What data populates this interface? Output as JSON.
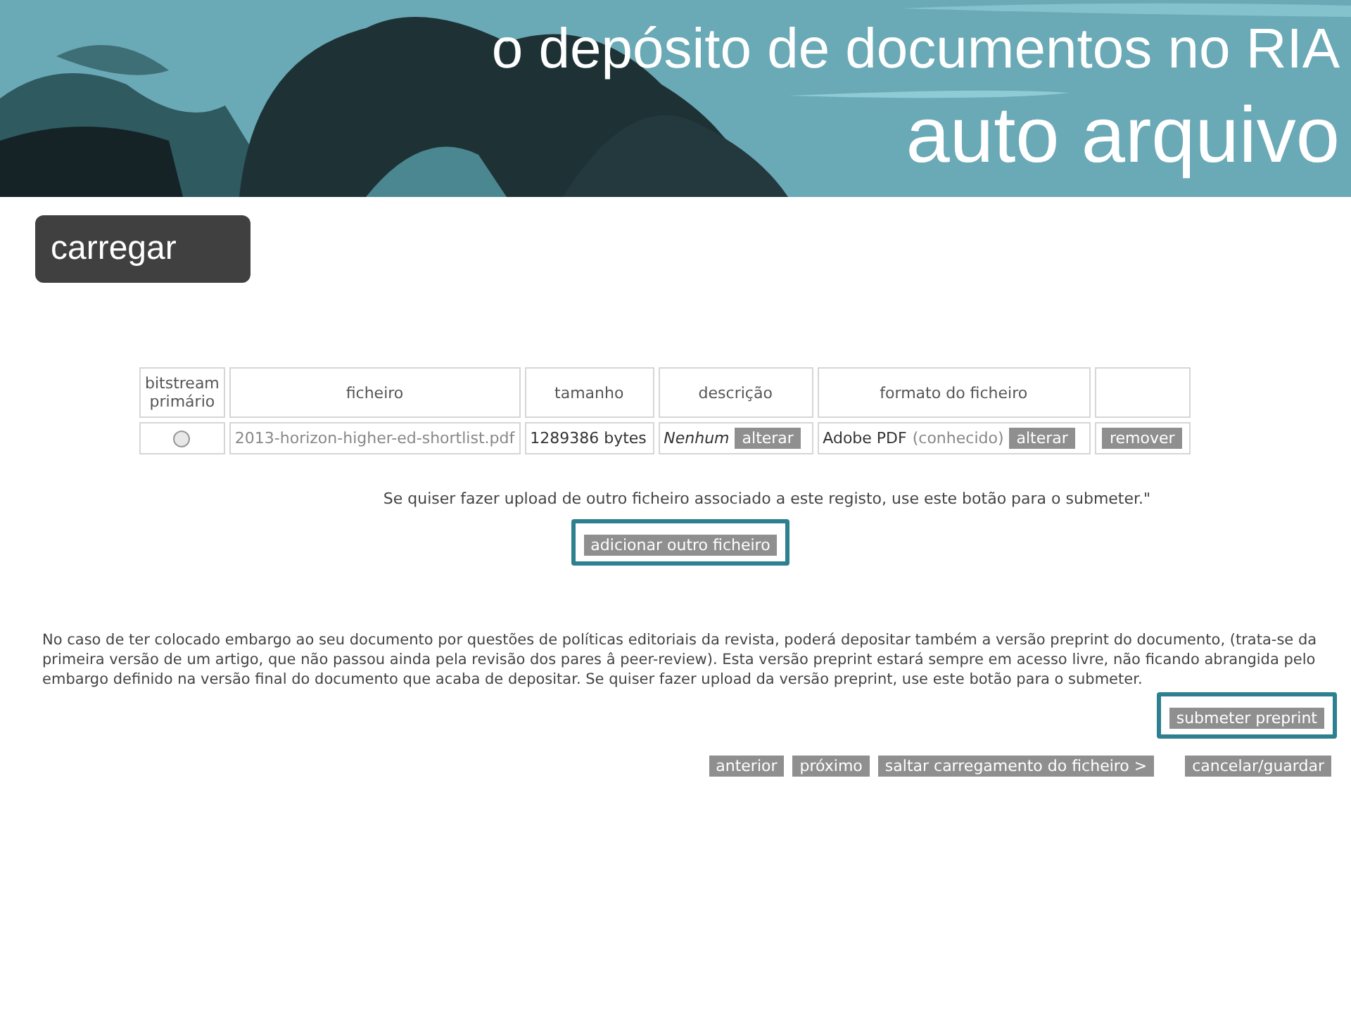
{
  "header": {
    "title": "o depósito de documentos no RIA",
    "subtitle": "auto arquivo"
  },
  "section_label": "carregar",
  "table": {
    "columns": [
      "bitstream primário",
      "ficheiro",
      "tamanho",
      "descrição",
      "formato do ficheiro"
    ],
    "rows": [
      {
        "primary_selected": false,
        "file": "2013-horizon-higher-ed-shortlist.pdf",
        "size": "1289386 bytes",
        "description": "Nenhum",
        "description_button": "alterar",
        "format": "Adobe PDF",
        "format_status": "(conhecido)",
        "format_button": "alterar",
        "remove_button": "remover"
      }
    ]
  },
  "upload_note": "Se quiser fazer upload de outro ficheiro associado a este registo, use este botão para o submeter.\"",
  "add_button": {
    "label": "adicionar outro ficheiro",
    "highlighted": true
  },
  "preprint_note": "No caso de ter colocado embargo ao seu documento por questões de políticas editoriais da revista, poderá depositar também a versão preprint do documento, (trata-se da primeira versão de um artigo, que não passou ainda pela revisão dos pares â peer-review). Esta versão preprint estará sempre em acesso livre, não ficando abrangida pelo embargo definido na versão final do documento que acaba de depositar. Se quiser fazer upload da versão preprint, use este botão para o submeter.",
  "preprint_button": {
    "label": "submeter preprint",
    "highlighted": true
  },
  "nav_buttons": [
    "anterior",
    "próximo",
    "saltar carregamento do ficheiro >",
    "cancelar/guardar"
  ]
}
